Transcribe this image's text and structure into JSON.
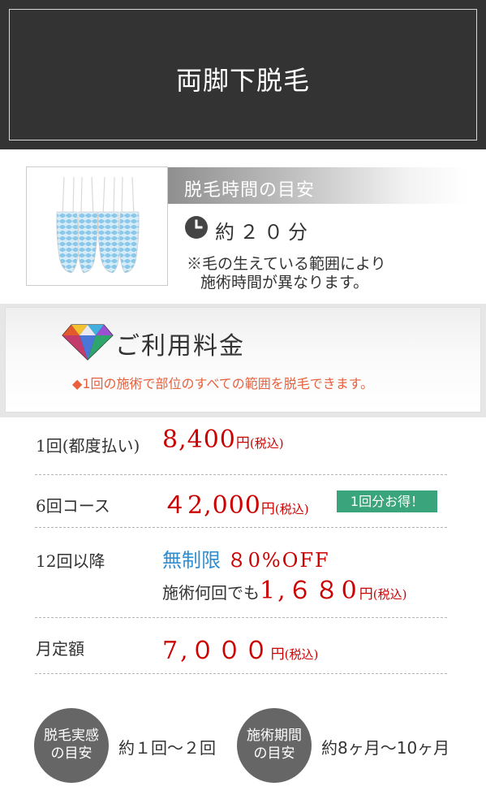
{
  "header": {
    "title": "両脚下脱毛"
  },
  "time": {
    "heading": "脱毛時間の目安",
    "value": "約２０分",
    "note_line1": "※毛の生えている範囲により",
    "note_line2": "施術時間が異なります。",
    "icons": {
      "clock": "clock-icon",
      "legs": "legs-illustration"
    }
  },
  "price": {
    "title": "ご利用料金",
    "note_mark": "◆",
    "note": "1回の施術で部位のすべての範囲を脱毛できます。",
    "rows": [
      {
        "label": "1回(都度払い)",
        "amount": "8,400",
        "unit": "円",
        "tax": "(税込)"
      },
      {
        "label": "6回コース",
        "amount": "４2,000",
        "unit": "円",
        "tax": "(税込)",
        "badge": "1回分お得！"
      },
      {
        "label": "12回以降",
        "unlimited": "無制限",
        "off": "８0%OFF",
        "sub_prefix": "施術何回でも",
        "amount": "1,６８0",
        "unit": "円",
        "tax": "(税込)"
      },
      {
        "label": "月定額",
        "amount": "7,０００",
        "unit": "円",
        "tax": "(税込)"
      }
    ]
  },
  "footer": {
    "feel_line1": "脱毛実感",
    "feel_line2": "の目安",
    "feel_value": "約１回〜２回",
    "period_line1": "施術期間",
    "period_line2": "の目安",
    "period_value": "約8ヶ月〜10ヶ月"
  },
  "colors": {
    "header_bg": "#333333",
    "price_red": "#cc0000",
    "accent_orange": "#e8603c",
    "badge_green": "#3aa57c",
    "blue": "#2f8ecf",
    "circle_gray": "#666666"
  }
}
